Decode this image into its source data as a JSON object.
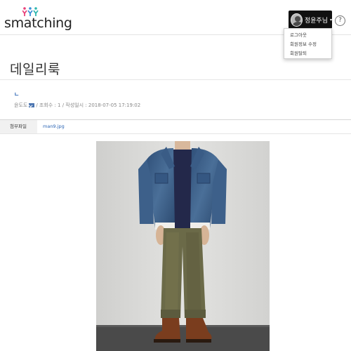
{
  "header": {
    "logo_text": "smatching",
    "user_name": "정윤주님",
    "caret": "▾",
    "help_icon": "?"
  },
  "dropdown": {
    "items": [
      "로그아웃",
      "회원정보 수정",
      "회원탈퇴"
    ]
  },
  "post": {
    "title": "데일리룩",
    "body_char": "ㄴ",
    "author": "윤도도",
    "views_label": " / 조회수 : 1 / 작성일시 : 2018-07-05 17:19:02"
  },
  "attachment": {
    "label": "첨부파일",
    "filename": "man9.jpg"
  },
  "colors": {
    "link": "#2a64b4",
    "header_border": "#e3e3e3",
    "user_button_bg": "#111111"
  },
  "icons": {
    "logo": "figures-logo-icon",
    "avatar": "avatar-icon",
    "mail": "mail-icon",
    "help": "help-icon"
  }
}
